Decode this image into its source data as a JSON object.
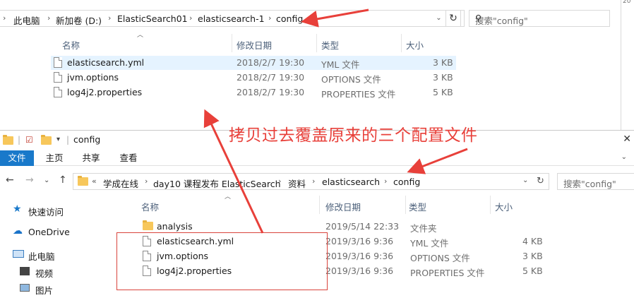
{
  "top_window": {
    "breadcrumb": [
      "此电脑",
      "新加卷 (D:)",
      "ElasticSearch01",
      "elasticsearch-1",
      "config"
    ],
    "search_placeholder": "搜索\"config\"",
    "corner_text": "20",
    "columns": {
      "name": "名称",
      "modified": "修改日期",
      "type": "类型",
      "size": "大小"
    },
    "files": [
      {
        "name": "elasticsearch.yml",
        "modified": "2018/2/7 19:30",
        "type": "YML 文件",
        "size": "3 KB",
        "selected": true
      },
      {
        "name": "jvm.options",
        "modified": "2018/2/7 19:30",
        "type": "OPTIONS 文件",
        "size": "3 KB",
        "selected": false
      },
      {
        "name": "log4j2.properties",
        "modified": "2018/2/7 19:30",
        "type": "PROPERTIES 文件",
        "size": "5 KB",
        "selected": false
      }
    ]
  },
  "bottom_window": {
    "title": "config",
    "ribbon_tabs": [
      "文件",
      "主页",
      "共享",
      "查看"
    ],
    "breadcrumb_prefix": "«",
    "breadcrumb": [
      "学成在线",
      "day10 课程发布 ElasticSearch",
      "资料",
      "elasticsearch",
      "config"
    ],
    "search_placeholder": "搜索\"config\"",
    "sidebar": [
      {
        "label": "快速访问",
        "icon": "star-icon"
      },
      {
        "label": "OneDrive",
        "icon": "cloud-icon"
      },
      {
        "label": "此电脑",
        "icon": "computer-icon"
      },
      {
        "label": "视频",
        "icon": "video-icon"
      },
      {
        "label": "图片",
        "icon": "picture-icon"
      }
    ],
    "columns": {
      "name": "名称",
      "modified": "修改日期",
      "type": "类型",
      "size": "大小"
    },
    "files": [
      {
        "name": "analysis",
        "modified": "2019/5/14 22:33",
        "type": "文件夹",
        "size": "",
        "is_folder": true
      },
      {
        "name": "elasticsearch.yml",
        "modified": "2019/3/16 9:36",
        "type": "YML 文件",
        "size": "4 KB",
        "is_folder": false
      },
      {
        "name": "jvm.options",
        "modified": "2019/3/16 9:36",
        "type": "OPTIONS 文件",
        "size": "3 KB",
        "is_folder": false
      },
      {
        "name": "log4j2.properties",
        "modified": "2019/3/16 9:36",
        "type": "PROPERTIES 文件",
        "size": "5 KB",
        "is_folder": false
      }
    ]
  },
  "annotation": {
    "text": "拷贝过去覆盖原来的三个配置文件",
    "color": "#e8403a"
  },
  "colors": {
    "accent": "#1979ca",
    "selection": "#e5f3ff",
    "header_text": "#4c607a"
  }
}
